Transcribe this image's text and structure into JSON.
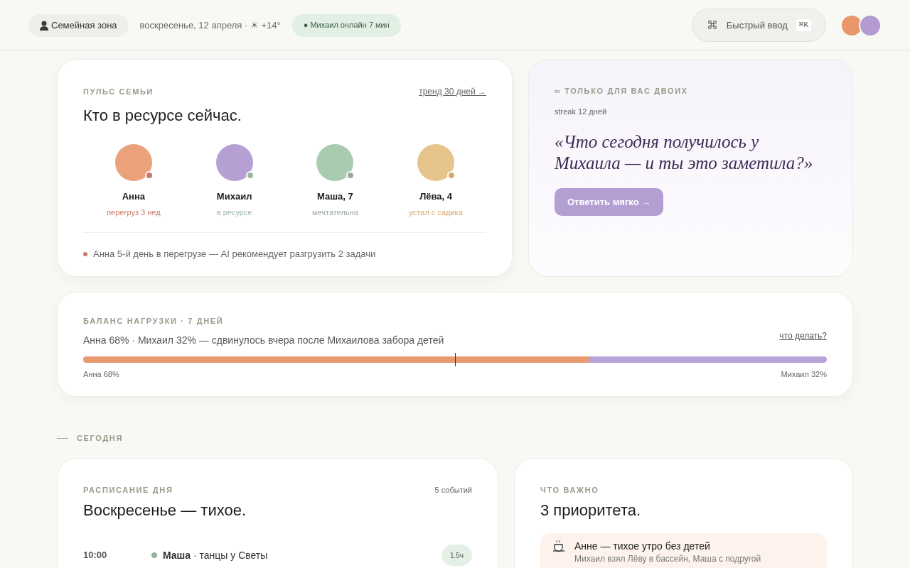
{
  "header": {
    "zone": "Семейная зона",
    "date": "воскресенье, 12 апреля · ☀ +14°",
    "presence": "● Михаил онлайн 7 мин",
    "quick_input": {
      "icon": "⌘",
      "label": "Быстрый ввод",
      "shortcut": "⌘K"
    },
    "avatars": [
      {
        "color": "#e8966a"
      },
      {
        "color": "#b39bd2"
      }
    ]
  },
  "pulse": {
    "eyebrow": "ПУЛЬС СЕМЬИ",
    "link": "тренд 30 дней →",
    "title": "Кто в ресурсе сейчас.",
    "members": [
      {
        "name": "Анна",
        "color": "#eba17a",
        "status": {
          "text": "перегруз 3 нед",
          "color": "#c97a66"
        }
      },
      {
        "name": "Михаил",
        "color": "#b59fd3",
        "status": {
          "text": "в ресурсе",
          "color": "#9bb5a6"
        }
      },
      {
        "name": "Маша, 7",
        "color": "#a9cbb0",
        "status": {
          "text": "мечтательна",
          "color": "#9aa8a0"
        }
      },
      {
        "name": "Лёва, 4",
        "color": "#e6c48c",
        "status": {
          "text": "устал с садика",
          "color": "#d6a867"
        }
      }
    ],
    "alert": {
      "color": "#c97a66",
      "text": "Анна 5-й день в перегрузе — AI рекомендует разгрузить 2 задачи"
    }
  },
  "couple": {
    "eyebrow": "∞ ТОЛЬКО ДЛЯ ВАС ДВОИХ",
    "streak": "streak 12 дней",
    "question": "«Что сегодня получилось у Михаила — и ты это заметила?»",
    "button": "Ответить мягко →"
  },
  "balance": {
    "eyebrow": "БАЛАНС НАГРУЗКИ · 7 ДНЕЙ",
    "summary": "Анна 68% · Михаил 32% — сдвинулось вчера после Михаилова забора детей",
    "link": "что делать?",
    "level": 0.68,
    "left_label": "Анна 68%",
    "right_label": "Михаил 32%"
  },
  "section": "СЕГОДНЯ",
  "schedule": {
    "eyebrow": "РАСПИСАНИЕ ДНЯ",
    "count": "5 событий",
    "title": "Воскресенье — тихое.",
    "events": [
      {
        "time": "10:00",
        "color": "#93b39c",
        "text": "**Маша** · танцы у Светы",
        "duration": "1.5ч"
      }
    ]
  },
  "priorities": {
    "eyebrow": "ЧТО ВАЖНО",
    "title": "3 приоритета.",
    "items": [
      {
        "title": "Анне — тихое утро без детей",
        "subtitle": "Михаил взял Лёву в бассейн, Маша с подругой"
      }
    ]
  }
}
